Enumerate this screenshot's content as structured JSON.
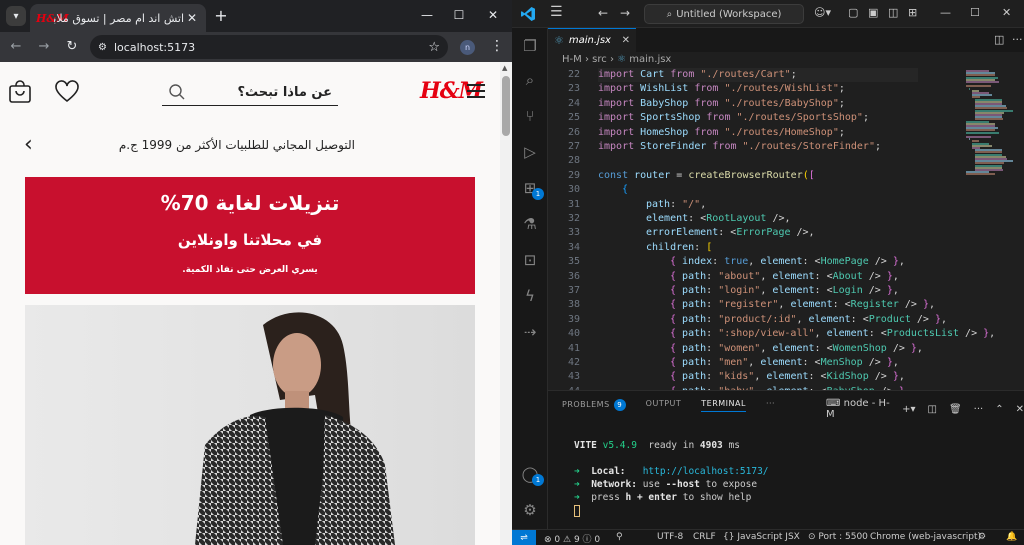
{
  "browser": {
    "tab_title": "اتش اند ام مصر | تسوق ملابس و",
    "tab_favicon": "H&M",
    "new_tab": "+",
    "url": "localhost:5173",
    "profile_initial": "n"
  },
  "hm": {
    "logo": "H&M",
    "search_placeholder": "عن ماذا تبحث؟",
    "promo_text": "التوصيل المجاني للطلبيات الأكثر من 1999 ج.م",
    "sale_title": "تنزيلات لغاية 70%",
    "sale_subtitle": "في محلاتنا واونلاين",
    "sale_note": "يسري العرض حتى نفاذ الكمية.",
    "colors": {
      "brand_red": "#e50010",
      "banner_red": "#c8102e"
    }
  },
  "vscode": {
    "command_center": "Untitled (Workspace)",
    "active_tab": "main.jsx",
    "breadcrumb": [
      "H-M",
      "src",
      "main.jsx"
    ],
    "activity_badge_1": "1",
    "activity_badge_2": "1",
    "code_lines": [
      {
        "n": "22",
        "indent": 0,
        "tokens": [
          [
            "kw",
            "import "
          ],
          [
            "id",
            "Cart "
          ],
          [
            "kw",
            "from "
          ],
          [
            "str",
            "\"./routes/Cart\""
          ],
          [
            "punc",
            ";"
          ]
        ]
      },
      {
        "n": "23",
        "indent": 0,
        "tokens": [
          [
            "kw",
            "import "
          ],
          [
            "id",
            "WishList "
          ],
          [
            "kw",
            "from "
          ],
          [
            "str",
            "\"./routes/WishList\""
          ],
          [
            "punc",
            ";"
          ]
        ]
      },
      {
        "n": "24",
        "indent": 0,
        "tokens": [
          [
            "kw",
            "import "
          ],
          [
            "id",
            "BabyShop "
          ],
          [
            "kw",
            "from "
          ],
          [
            "str",
            "\"./routes/BabyShop\""
          ],
          [
            "punc",
            ";"
          ]
        ]
      },
      {
        "n": "25",
        "indent": 0,
        "tokens": [
          [
            "kw",
            "import "
          ],
          [
            "id",
            "SportsShop "
          ],
          [
            "kw",
            "from "
          ],
          [
            "str",
            "\"./routes/SportsShop\""
          ],
          [
            "punc",
            ";"
          ]
        ]
      },
      {
        "n": "26",
        "indent": 0,
        "tokens": [
          [
            "kw",
            "import "
          ],
          [
            "id",
            "HomeShop "
          ],
          [
            "kw",
            "from "
          ],
          [
            "str",
            "\"./routes/HomeShop\""
          ],
          [
            "punc",
            ";"
          ]
        ]
      },
      {
        "n": "27",
        "indent": 0,
        "tokens": [
          [
            "kw",
            "import "
          ],
          [
            "id",
            "StoreFinder "
          ],
          [
            "kw",
            "from "
          ],
          [
            "str",
            "\"./routes/StoreFinder\""
          ],
          [
            "punc",
            ";"
          ]
        ]
      },
      {
        "n": "28",
        "indent": 0,
        "tokens": []
      },
      {
        "n": "29",
        "indent": 0,
        "tokens": [
          [
            "kw2",
            "const "
          ],
          [
            "id",
            "router "
          ],
          [
            "punc",
            "= "
          ],
          [
            "fn",
            "createBrowserRouter"
          ],
          [
            "br1",
            "("
          ],
          [
            "br2",
            "["
          ]
        ]
      },
      {
        "n": "30",
        "indent": 1,
        "tokens": [
          [
            "br3",
            "{"
          ]
        ]
      },
      {
        "n": "31",
        "indent": 2,
        "tokens": [
          [
            "id",
            "path"
          ],
          [
            "punc",
            ": "
          ],
          [
            "str",
            "\"/\""
          ],
          [
            "punc",
            ","
          ]
        ]
      },
      {
        "n": "32",
        "indent": 2,
        "tokens": [
          [
            "id",
            "element"
          ],
          [
            "punc",
            ": <"
          ],
          [
            "comp",
            "RootLayout"
          ],
          [
            "punc",
            " />,"
          ]
        ]
      },
      {
        "n": "33",
        "indent": 2,
        "tokens": [
          [
            "id",
            "errorElement"
          ],
          [
            "punc",
            ": <"
          ],
          [
            "comp",
            "ErrorPage"
          ],
          [
            "punc",
            " />,"
          ]
        ]
      },
      {
        "n": "34",
        "indent": 2,
        "tokens": [
          [
            "id",
            "children"
          ],
          [
            "punc",
            ": "
          ],
          [
            "br1",
            "["
          ]
        ]
      },
      {
        "n": "35",
        "indent": 3,
        "tokens": [
          [
            "br2",
            "{ "
          ],
          [
            "id",
            "index"
          ],
          [
            "punc",
            ": "
          ],
          [
            "kw2",
            "true"
          ],
          [
            "punc",
            ", "
          ],
          [
            "id",
            "element"
          ],
          [
            "punc",
            ": <"
          ],
          [
            "comp",
            "HomePage"
          ],
          [
            "punc",
            " /> "
          ],
          [
            "br2",
            "}"
          ],
          [
            "punc",
            ","
          ]
        ]
      },
      {
        "n": "36",
        "indent": 3,
        "tokens": [
          [
            "br2",
            "{ "
          ],
          [
            "id",
            "path"
          ],
          [
            "punc",
            ": "
          ],
          [
            "str",
            "\"about\""
          ],
          [
            "punc",
            ", "
          ],
          [
            "id",
            "element"
          ],
          [
            "punc",
            ": <"
          ],
          [
            "comp",
            "About"
          ],
          [
            "punc",
            " /> "
          ],
          [
            "br2",
            "}"
          ],
          [
            "punc",
            ","
          ]
        ]
      },
      {
        "n": "37",
        "indent": 3,
        "tokens": [
          [
            "br2",
            "{ "
          ],
          [
            "id",
            "path"
          ],
          [
            "punc",
            ": "
          ],
          [
            "str",
            "\"login\""
          ],
          [
            "punc",
            ", "
          ],
          [
            "id",
            "element"
          ],
          [
            "punc",
            ": <"
          ],
          [
            "comp",
            "Login"
          ],
          [
            "punc",
            " /> "
          ],
          [
            "br2",
            "}"
          ],
          [
            "punc",
            ","
          ]
        ]
      },
      {
        "n": "38",
        "indent": 3,
        "tokens": [
          [
            "br2",
            "{ "
          ],
          [
            "id",
            "path"
          ],
          [
            "punc",
            ": "
          ],
          [
            "str",
            "\"register\""
          ],
          [
            "punc",
            ", "
          ],
          [
            "id",
            "element"
          ],
          [
            "punc",
            ": <"
          ],
          [
            "comp",
            "Register"
          ],
          [
            "punc",
            " /> "
          ],
          [
            "br2",
            "}"
          ],
          [
            "punc",
            ","
          ]
        ]
      },
      {
        "n": "39",
        "indent": 3,
        "tokens": [
          [
            "br2",
            "{ "
          ],
          [
            "id",
            "path"
          ],
          [
            "punc",
            ": "
          ],
          [
            "str",
            "\"product/:id\""
          ],
          [
            "punc",
            ", "
          ],
          [
            "id",
            "element"
          ],
          [
            "punc",
            ": <"
          ],
          [
            "comp",
            "Product"
          ],
          [
            "punc",
            " /> "
          ],
          [
            "br2",
            "}"
          ],
          [
            "punc",
            ","
          ]
        ]
      },
      {
        "n": "40",
        "indent": 3,
        "tokens": [
          [
            "br2",
            "{ "
          ],
          [
            "id",
            "path"
          ],
          [
            "punc",
            ": "
          ],
          [
            "str",
            "\":shop/view-all\""
          ],
          [
            "punc",
            ", "
          ],
          [
            "id",
            "element"
          ],
          [
            "punc",
            ": <"
          ],
          [
            "comp",
            "ProductsList"
          ],
          [
            "punc",
            " /> "
          ],
          [
            "br2",
            "}"
          ],
          [
            "punc",
            ","
          ]
        ]
      },
      {
        "n": "41",
        "indent": 3,
        "tokens": [
          [
            "br2",
            "{ "
          ],
          [
            "id",
            "path"
          ],
          [
            "punc",
            ": "
          ],
          [
            "str",
            "\"women\""
          ],
          [
            "punc",
            ", "
          ],
          [
            "id",
            "element"
          ],
          [
            "punc",
            ": <"
          ],
          [
            "comp",
            "WomenShop"
          ],
          [
            "punc",
            " /> "
          ],
          [
            "br2",
            "}"
          ],
          [
            "punc",
            ","
          ]
        ]
      },
      {
        "n": "42",
        "indent": 3,
        "tokens": [
          [
            "br2",
            "{ "
          ],
          [
            "id",
            "path"
          ],
          [
            "punc",
            ": "
          ],
          [
            "str",
            "\"men\""
          ],
          [
            "punc",
            ", "
          ],
          [
            "id",
            "element"
          ],
          [
            "punc",
            ": <"
          ],
          [
            "comp",
            "MenShop"
          ],
          [
            "punc",
            " /> "
          ],
          [
            "br2",
            "}"
          ],
          [
            "punc",
            ","
          ]
        ]
      },
      {
        "n": "43",
        "indent": 3,
        "tokens": [
          [
            "br2",
            "{ "
          ],
          [
            "id",
            "path"
          ],
          [
            "punc",
            ": "
          ],
          [
            "str",
            "\"kids\""
          ],
          [
            "punc",
            ", "
          ],
          [
            "id",
            "element"
          ],
          [
            "punc",
            ": <"
          ],
          [
            "comp",
            "KidShop"
          ],
          [
            "punc",
            " /> "
          ],
          [
            "br2",
            "}"
          ],
          [
            "punc",
            ","
          ]
        ]
      },
      {
        "n": "44",
        "indent": 3,
        "tokens": [
          [
            "br2",
            "{ "
          ],
          [
            "id",
            "path"
          ],
          [
            "punc",
            ": "
          ],
          [
            "str",
            "\"baby\""
          ],
          [
            "punc",
            ", "
          ],
          [
            "id",
            "element"
          ],
          [
            "punc",
            ": <"
          ],
          [
            "comp",
            "BabyShop"
          ],
          [
            "punc",
            " /> "
          ],
          [
            "br2",
            "}"
          ],
          [
            "punc",
            ","
          ]
        ]
      }
    ],
    "panel": {
      "tabs": [
        "PROBLEMS",
        "OUTPUT",
        "TERMINAL"
      ],
      "problems_count": "9",
      "more": "···",
      "terminal_name": "node - H-M"
    },
    "terminal": {
      "vite_label": "VITE",
      "vite_version": "v5.4.9",
      "ready_prefix": "ready in ",
      "ready_ms": "4903",
      "ready_unit": " ms",
      "local_label": "Local:",
      "local_url": "http://localhost:5173/",
      "network_label": "Network:",
      "network_use": "use ",
      "network_flag": "--host",
      "network_tail": " to expose",
      "help_prefix": "press ",
      "help_key": "h + enter",
      "help_tail": " to show help"
    },
    "status": {
      "errors": "0",
      "warnings": "9",
      "info": "0",
      "encoding": "UTF-8",
      "eol": "CRLF",
      "language": "JavaScript JSX",
      "port": "Port : 5500",
      "profile": "Chrome (web-javascript)"
    }
  }
}
